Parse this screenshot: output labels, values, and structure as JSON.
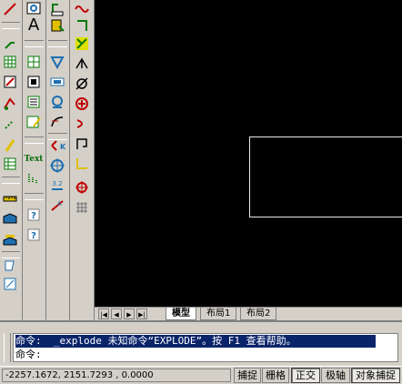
{
  "colors": {
    "canvas": "#000000",
    "selection": "#0a246a",
    "chrome": "#d4d0c8"
  },
  "toolbars": {
    "left": [
      "line-icon",
      "text-A-icon",
      "dimension-icon",
      "edit-table-icon",
      "block-icon",
      "hatch-icon",
      "hyperlink-icon",
      "table-icon",
      "measure-icon",
      "ruler-icon",
      "layer-icon",
      "layer-states-icon",
      "tool-icon",
      "tool-2-icon"
    ],
    "mid1": [
      "zoom-window-icon",
      "text-a-icon",
      "arc-tool-icon",
      "grid-icon",
      "block-insert-icon",
      "properties-icon",
      "match-icon",
      "text-style-icon",
      "dots-icon",
      "help-icon",
      "help-2-icon"
    ],
    "mid2": [
      "spline-icon",
      "note-icon",
      "triangle-icon",
      "image-icon",
      "camera-icon",
      "target-icon",
      "radius-icon",
      "dimstyle-icon",
      "dimstyle-2-icon"
    ],
    "right": [
      "wave-icon",
      "angle-icon",
      "snap-icon",
      "chevron-icon",
      "diameter-icon",
      "plus-circle-icon",
      "minus-icon",
      "bracket-icon",
      "align-icon",
      "target-2-icon",
      "array-icon"
    ],
    "text_label": "Text"
  },
  "tabs": {
    "model": "模型",
    "layout1": "布局1",
    "layout2": "布局2"
  },
  "command": {
    "history": "命令:  _explode 未知命令“EXPLODE”。按 F1 查看帮助。",
    "prompt": "命令:"
  },
  "status": {
    "coords": "-2257.1672, 2151.7293 , 0.0000",
    "buttons": [
      "捕捉",
      "栅格",
      "正交",
      "极轴",
      "对象捕捉"
    ]
  }
}
